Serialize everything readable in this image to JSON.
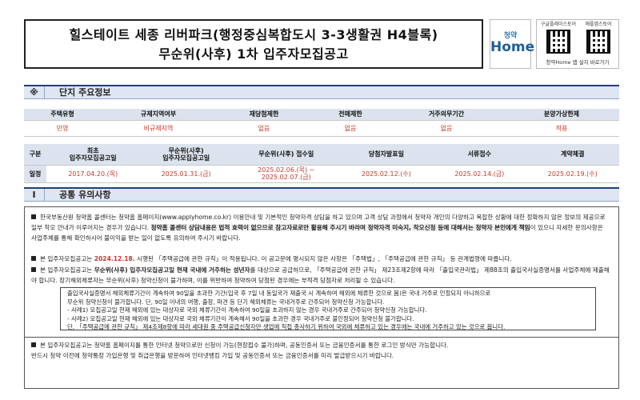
{
  "header": {
    "title_line1": "힐스테이트 세종 리버파크(행정중심복합도시 3-3생활권 H4블록)",
    "title_line2": "무순위(사후) 1차 입주자모집공고",
    "logo_top": "청약",
    "logo_main": "Home",
    "qr_left_label": "구글플레이스토어",
    "qr_right_label": "애플앱스토어",
    "qr_caption": "청약Home 앱 설치 바로가기"
  },
  "section1": {
    "mark": "※",
    "title": "단지 주요정보"
  },
  "info_table": {
    "headers": [
      "주택유형",
      "규제지역여부",
      "재당첨제한",
      "전매제한",
      "거주의무기간",
      "분양가상한제"
    ],
    "values": [
      "민영",
      "비규제지역",
      "없음",
      "없음",
      "없음",
      "적용"
    ]
  },
  "schedule_table": {
    "headers": [
      "구분",
      "최초\n입주자모집공고일",
      "무순위(사후)\n입주자모집공고일",
      "무순위(사후) 접수일",
      "당첨자발표일",
      "서류접수",
      "계약체결"
    ],
    "row_label": "일정",
    "values": [
      "2017.04.20.(목)",
      "2025.01.31.(금)",
      "2025.02.06.(목) ~\n2025.02.07.(금)",
      "2025.02.12.(수)",
      "2025.02.14.(금)",
      "2025.02.19.(수)"
    ]
  },
  "section2": {
    "mark": "I",
    "title": "공통 유의사항"
  },
  "notice": {
    "p1_a": "한국부동산원 청약홈 콜센터는 청약홈 홈페이지(www.applyhome.co.kr) 이용안내 및 기본적인 청약자격 상담을 하고 있으며 고객 상담 과정에서 청약자 개인의 다양하고 복잡한 상황에 대한 정확하지 않은 정보의 제공으로 일부 착오 안내가 이루어지는 경우가 있습니다.",
    "p1_b": "청약홈 콜센터 상담내용은 법적 효력이 없으므로 참고자료로만 활용해 주시기 바라며 청약자격 미숙지, 착오신청 등에 대해서는 청약자 본인에게 책임",
    "p1_c": "이 있으니 자세한 문의사항은 사업주체를 통해 확인하시어 불이익을 받는 일이 없도록 유의하여 주시기 바랍니다.",
    "p2_a": "본 입주자모집공고는",
    "p2_date": "2024.12.18.",
    "p2_b": "시행된 「주택공급에 관한 규칙」이 적용됩니다. 이 공고문에 명시되지 않은 사항은 「주택법」, 「주택공급에 관한 규칙」 등 관계법령에 따릅니다.",
    "p3_a": "본 입주자모집공고는",
    "p3_b": "무순위(사후) 입주자모집공고일 현재 국내에 거주하는 성년자",
    "p3_c": "를 대상으로 공급하므로, 「주택공급에 관한 규칙」 제23조제2항에 따라 「출입국관리법」 제88조의 출입국사실증명서를 사업주체에 제출해야 합니다. 장기해외체류자는 무순위(사후) 청약신청이 불가하며, 이를 위반하여 청약하여 당첨된 경우에는 부적격 당첨자로 처리될 수 있습니다.",
    "box_lines": [
      "출입국사실증명서 해외체류기간이 계속하여 90일을 초과한 기간(입국 후 7일 내 동일국가 재출국 시 계속하여 해외에 체류한 것으로 봄)은 국내 거주로 인정되지 아니하므로",
      "무순위 청약신청이 불가합니다. 단, 90일 이내의 여행, 출장, 파견 등 단기 해외체류는 국내거주로 간주되어 청약신청 가능합니다.",
      "- 사례1) 모집공고일 현재 해외에 있는 대상자로 국외 체류기간이 계속하여 90일을 초과하지 않는 경우 국내거주로 간주되어 청약신청 가능합니다.",
      "- 사례2) 모집공고일 현재 해외에 있는 대상자로 국외 체류기간이 계속해서 90일을 초과한 경우 국내거주로 불인정되어 청약신청 불가합니다.",
      "단, 「주택공급에 관한 규칙」 제4조제8항에 따라 세대원 중 주택공급신청자만 생업에 직접 종사하기 위하여 국외에 체류하고 있는 경우에는 국내에 거주하고 있는 것으로 봅니다."
    ],
    "p4": "본 입주자모집공고는 청약홈 홈페이지를 통한 인터넷 청약으로만 신청이 가능(현장접수 불가)하며, 공동인증서 또는 금융인증서를 통한 로그인 방식만 가능합니다.",
    "p4_b": "반드시 청약 이전에 청약통장 가입은행 및 취급은행을 방문하여 인터넷뱅킹 가입 및 공동인증서 또는 금융인증서를 미리 발급받으시기 바랍니다."
  },
  "colors": {
    "accent": "#1f3f7a",
    "highlight": "#c0392b",
    "header_bg": "#dde3ee"
  }
}
